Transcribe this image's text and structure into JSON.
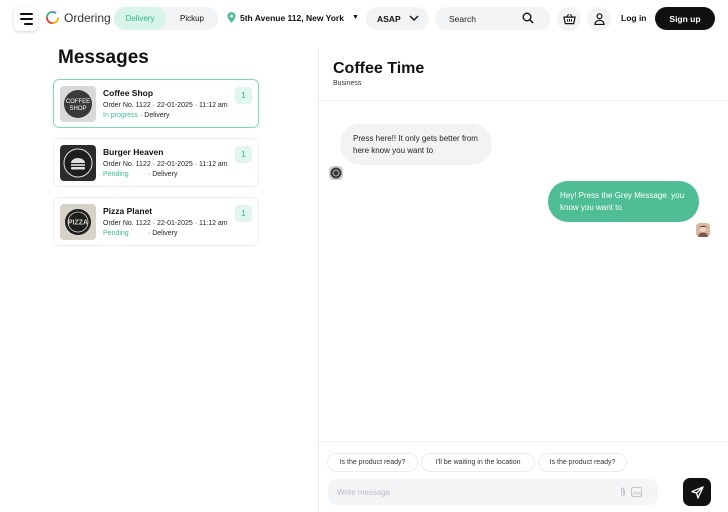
{
  "header": {
    "logo_text": "Ordering",
    "delivery_options": [
      "Delivery",
      "Pickup"
    ],
    "selected_option": "Delivery",
    "address": "5th Avenue 112, New York",
    "time": "ASAP",
    "search_placeholder": "Search",
    "login_label": "Log in",
    "signup_label": "Sign up"
  },
  "messages": {
    "title": "Messages",
    "conversations": [
      {
        "name": "Coffee Shop",
        "order": "Order No. 1122 · 22-01-2025 · 11:12 am",
        "status": "In progress",
        "type": "· Delivery",
        "unread": "1",
        "active": true,
        "avatar_icon": "coffee-shop-logo"
      },
      {
        "name": "Burger Heaven",
        "order": "Order No. 1122 · 22-01-2025 · 11:12 am",
        "status": "Pending",
        "type": "· Delivery",
        "unread": "1",
        "active": false,
        "avatar_icon": "burger-logo"
      },
      {
        "name": "Pizza Planet",
        "order": "Order No. 1122 · 22-01-2025 · 11:12 am",
        "status": "Pending",
        "type": "· Delivery",
        "unread": "1",
        "active": false,
        "avatar_icon": "pizza-logo"
      }
    ]
  },
  "chat": {
    "title": "Coffee Time",
    "subtitle": "Business",
    "messages": [
      {
        "from": "business",
        "text": "Press here!! It only gets better from here know you want to"
      },
      {
        "from": "user",
        "text": "Hey! Press the Grey Message. you know you want to"
      }
    ],
    "quick_replies": [
      "Is the product ready?",
      "I'll be waiting in the location",
      "Is the product ready?"
    ],
    "composer_placeholder": "Write message"
  },
  "colors": {
    "accent": "#4fbe95",
    "accent_light": "#d8f3e8",
    "dark": "#111111"
  }
}
